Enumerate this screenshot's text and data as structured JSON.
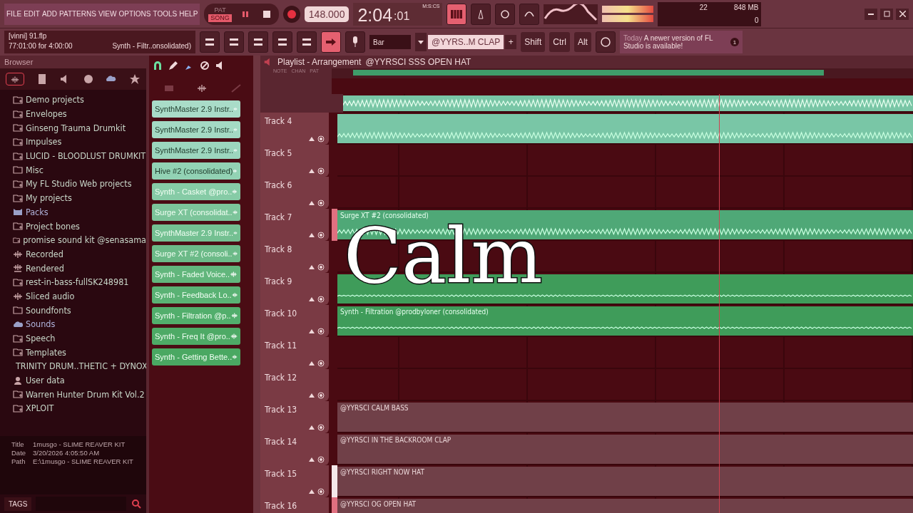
{
  "menu": [
    "FILE",
    "EDIT",
    "ADD",
    "PATTERNS",
    "VIEW",
    "OPTIONS",
    "TOOLS",
    "HELP"
  ],
  "transport": {
    "modes": [
      {
        "label": "PAT",
        "selected": false
      },
      {
        "label": "SONG",
        "selected": true
      }
    ],
    "tempo": "148.000",
    "time": "2:04",
    "time_cs": ":01",
    "time_unit": "M:S:CS"
  },
  "monitor": {
    "cpu": "22",
    "memory": "848 MB",
    "polyphony": "0"
  },
  "hint": {
    "file": "[vinni] 91.flp",
    "position": "77:01:00 for 4:00:00",
    "clip": "Synth - Filtr..onsolidated)"
  },
  "snap": "Bar",
  "pattern": "@YYRS..M CLAP",
  "pattern_add": "+",
  "modifiers": [
    "Shift",
    "Ctrl",
    "Alt"
  ],
  "news": {
    "when": "Today",
    "message": "A newer version of FL Studio is available!",
    "count": "1"
  },
  "browser": {
    "title": "Browser",
    "items": [
      {
        "kind": "folder",
        "label": "Demo projects"
      },
      {
        "kind": "folder",
        "label": "Envelopes"
      },
      {
        "kind": "folder",
        "label": "Ginseng Trauma Drumkit"
      },
      {
        "kind": "folder",
        "label": "Impulses"
      },
      {
        "kind": "folder",
        "label": "LUCID - BLOODLUST DRUMKIT"
      },
      {
        "kind": "plain",
        "label": "Misc"
      },
      {
        "kind": "folder",
        "label": "My FL Studio Web projects"
      },
      {
        "kind": "folder",
        "label": "My projects"
      },
      {
        "kind": "packs",
        "label": "Packs"
      },
      {
        "kind": "folder",
        "label": "Project bones"
      },
      {
        "kind": "folder",
        "label": "promise sound kit @senasama"
      },
      {
        "kind": "audio",
        "label": "Recorded"
      },
      {
        "kind": "rendered",
        "label": "Rendered"
      },
      {
        "kind": "folder",
        "label": "rest-in-bass-fullSK248981"
      },
      {
        "kind": "audio",
        "label": "Sliced audio"
      },
      {
        "kind": "plain",
        "label": "Soundfonts"
      },
      {
        "kind": "cloud",
        "label": "Sounds"
      },
      {
        "kind": "folder",
        "label": "Speech"
      },
      {
        "kind": "folder",
        "label": "Templates"
      },
      {
        "kind": "folder",
        "label": "TRINITY DRUM..THETIC + DYNOX"
      },
      {
        "kind": "user",
        "label": "User data"
      },
      {
        "kind": "folder",
        "label": "Warren Hunter Drum Kit Vol.2"
      },
      {
        "kind": "folder",
        "label": "XPLOIT"
      }
    ],
    "info": [
      {
        "key": "Title",
        "value": "1musgo - SLIME REAVER KIT"
      },
      {
        "key": "Date",
        "value": "3/20/2026 4:05:50 AM"
      },
      {
        "key": "Path",
        "value": "E:\\1musgo - SLIME REAVER KIT"
      }
    ],
    "tags": "TAGS"
  },
  "clips": [
    {
      "label": "SynthMaster 2.9 Instr..",
      "color": "#a9dcc8"
    },
    {
      "label": "SynthMaster 2.9 Instr..",
      "color": "#a4dac4"
    },
    {
      "label": "SynthMaster 2.9 Instr..",
      "color": "#9cd6be"
    },
    {
      "label": "Hive #2 (consolidated)",
      "color": "#92d2b4"
    },
    {
      "label": "Synth - Casket @pro..",
      "color": "#86cba6"
    },
    {
      "label": "Surge XT (consolidat..",
      "color": "#7cc49a"
    },
    {
      "label": "SynthMaster 2.9 Instr..",
      "color": "#74c092"
    },
    {
      "label": "Surge XT #2 (consoli..",
      "color": "#6cba88"
    },
    {
      "label": "Synth - Faded Voice..",
      "color": "#62b67c"
    },
    {
      "label": "Synth - Feedback Lo..",
      "color": "#5ab274"
    },
    {
      "label": "Synth - Filtration @p..",
      "color": "#52ae6c"
    },
    {
      "label": "Synth - Freq It @pro..",
      "color": "#4eaa66"
    },
    {
      "label": "Synth - Getting Bette..",
      "color": "#4aa862"
    }
  ],
  "playlist": {
    "title": "Playlist - Arrangement",
    "pattern": "@YYRSCI SSS OPEN HAT",
    "picker": [
      "NOTE",
      "CHAN",
      "PAT"
    ],
    "tracks": [
      {
        "name": "Track 4",
        "clip": {
          "kind": "audio"
        }
      },
      {
        "name": "Track 5"
      },
      {
        "name": "Track 6"
      },
      {
        "name": "Track 7",
        "color": "#e07080",
        "clip": {
          "kind": "audio2",
          "label": "Surge XT #2 (consolidated)"
        }
      },
      {
        "name": "Track 8"
      },
      {
        "name": "Track 9",
        "clip": {
          "kind": "synth"
        }
      },
      {
        "name": "Track 10",
        "clip": {
          "kind": "synth",
          "label": "Synth - Filtration @prodbyloner (consolidated)"
        }
      },
      {
        "name": "Track 11"
      },
      {
        "name": "Track 12"
      },
      {
        "name": "Track 13",
        "clip": {
          "kind": "pattern",
          "label": "@YYRSCI CALM BASS"
        }
      },
      {
        "name": "Track 14",
        "clip": {
          "kind": "pattern",
          "label": "@YYRSCI IN THE BACKROOM CLAP"
        }
      },
      {
        "name": "Track 15",
        "color": "#f5e8ea",
        "clip": {
          "kind": "pattern",
          "label": "@YYRSCI RIGHT NOW HAT"
        }
      },
      {
        "name": "Track 16",
        "color": "#e07080",
        "clip": {
          "kind": "pattern",
          "label": "@YYRSCI OG OPEN HAT"
        }
      }
    ]
  },
  "caption": "Calm"
}
